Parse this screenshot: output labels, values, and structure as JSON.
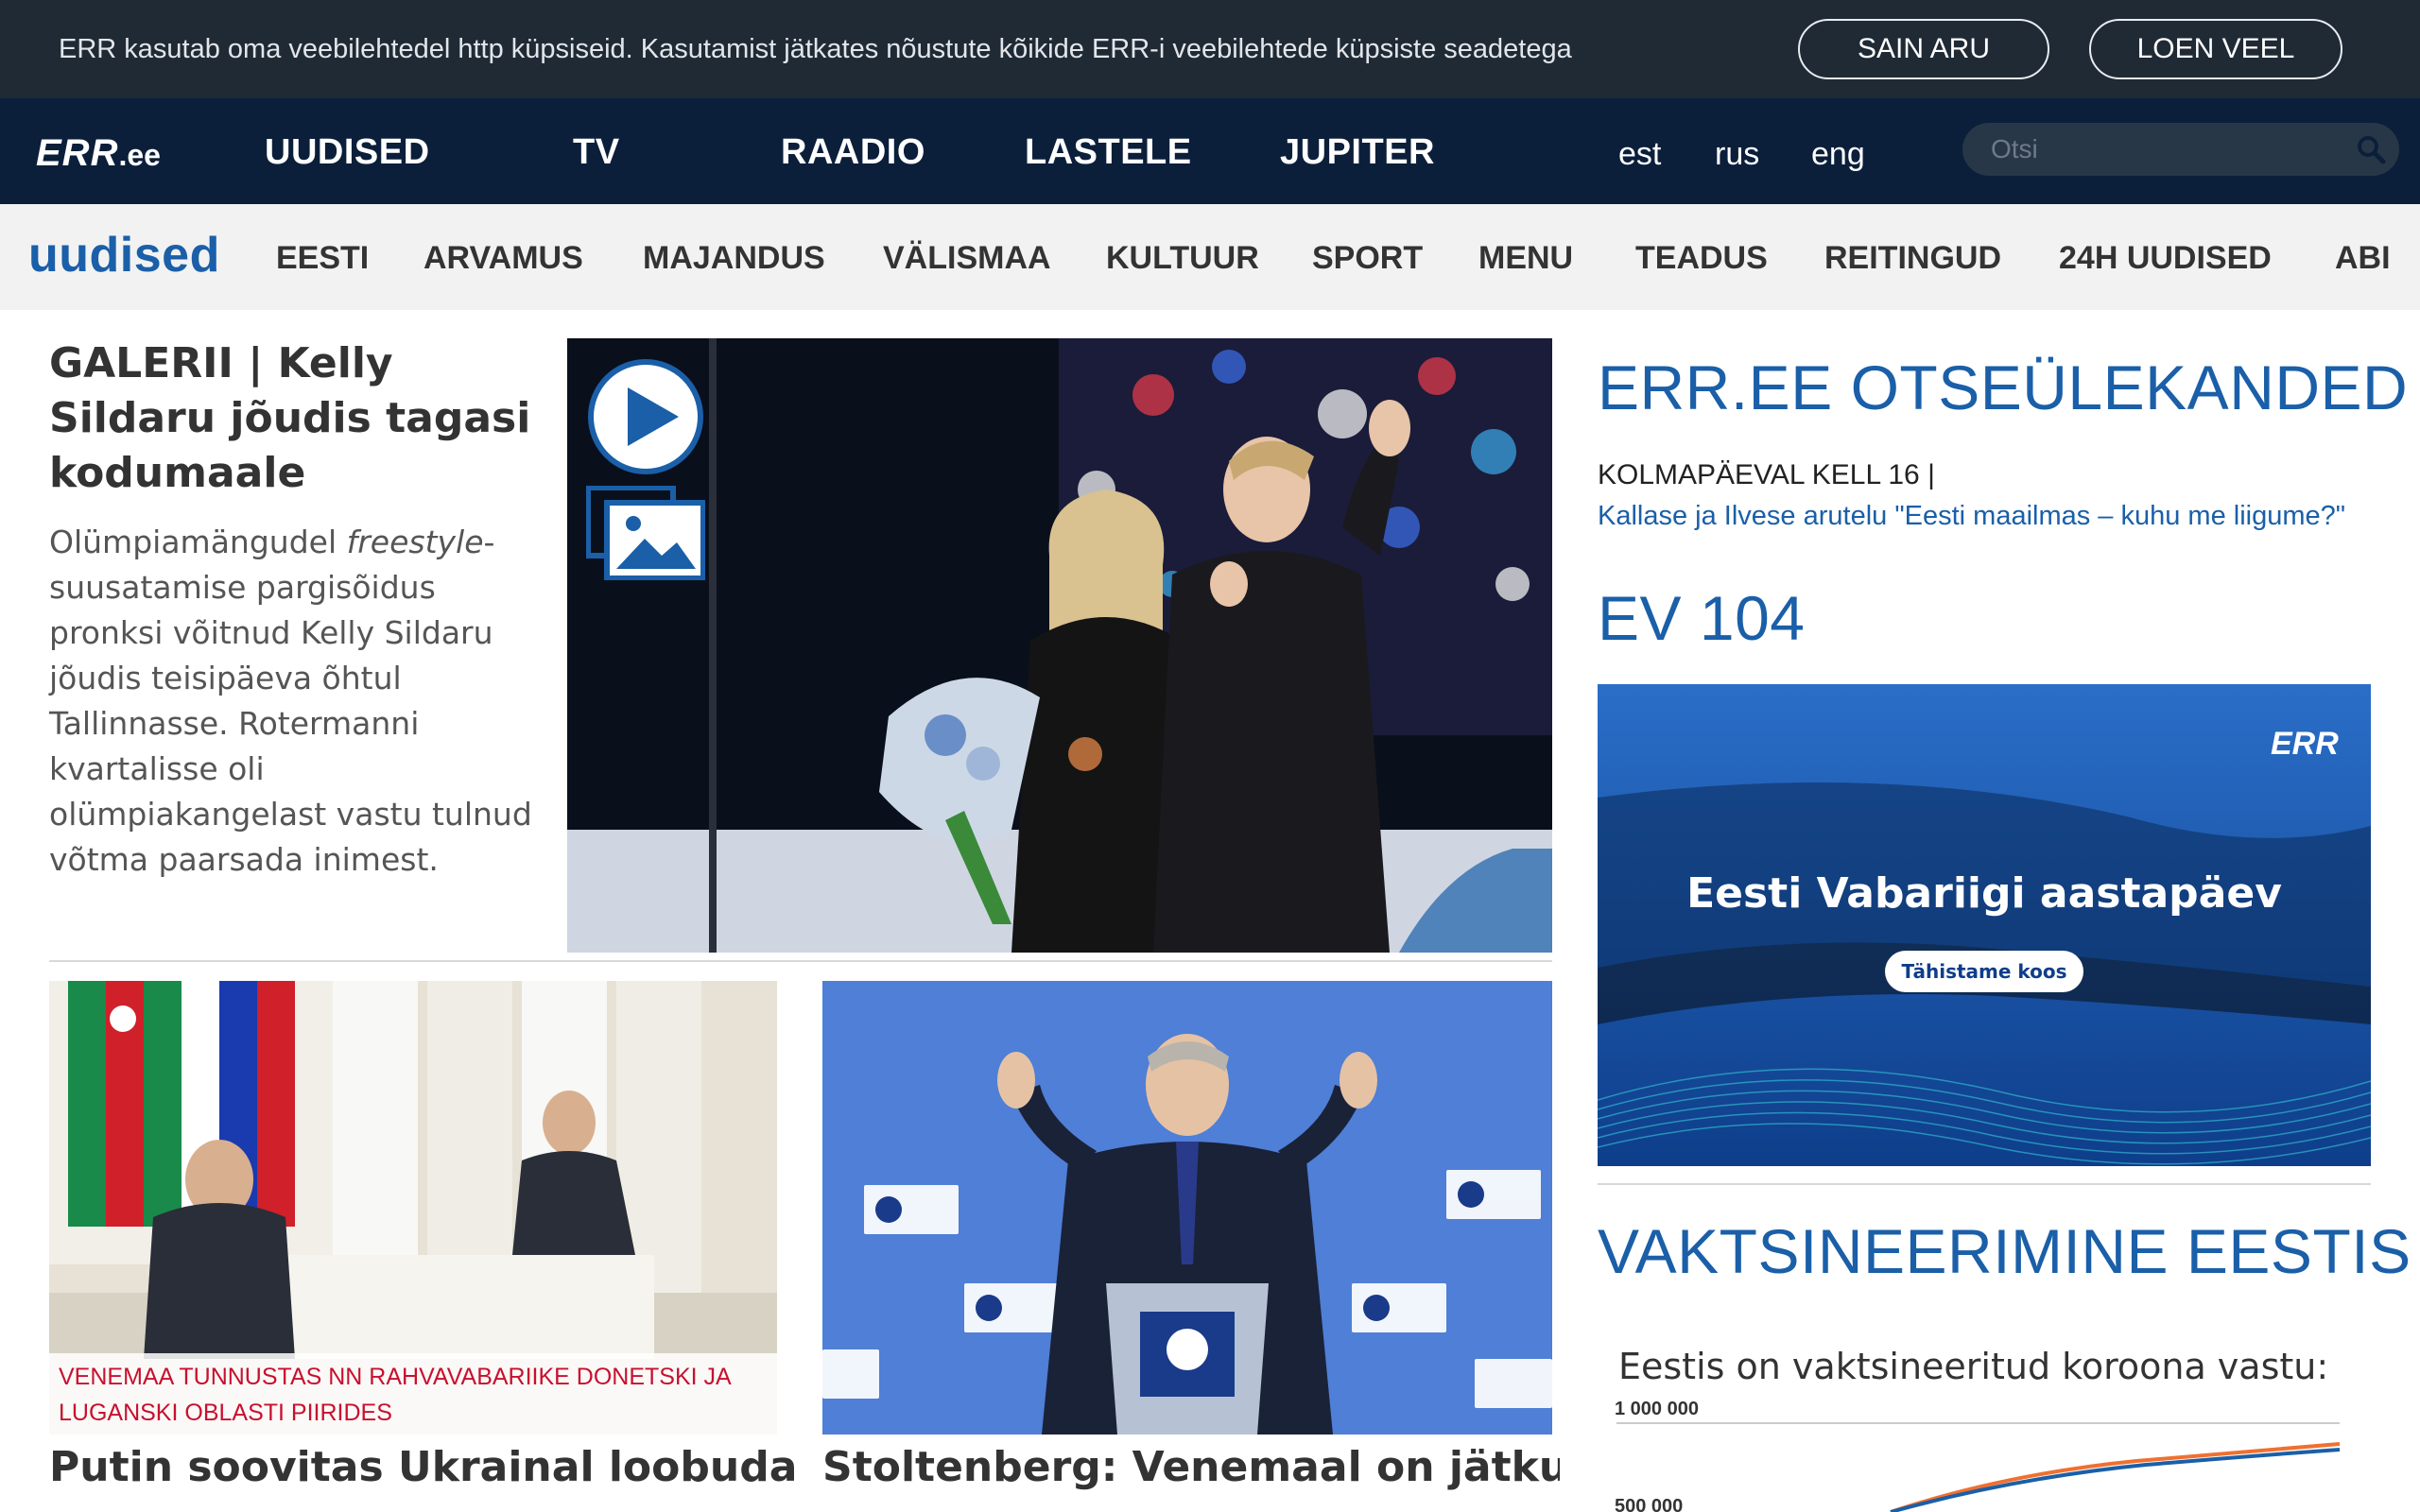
{
  "cookie_bar": {
    "text": "ERR kasutab oma veebilehtedel http küpsiseid. Kasutamist jätkates nõustute kõikide ERR-i veebilehtede küpsiste seadetega",
    "agree_label": "SAIN ARU",
    "more_label": "LOEN VEEL"
  },
  "header": {
    "logo_err": "ERR",
    "logo_ee": ".ee",
    "nav": [
      "UUDISED",
      "TV",
      "RAADIO",
      "LASTELE",
      "JUPITER"
    ],
    "langs": [
      "est",
      "rus",
      "eng"
    ],
    "search_placeholder": "Otsi"
  },
  "section_nav": {
    "brand": "uudised",
    "items": [
      "EESTI",
      "ARVAMUS",
      "MAJANDUS",
      "VÄLISMAA",
      "KULTUUR",
      "SPORT",
      "MENU",
      "TEADUS",
      "REITINGUD",
      "24H UUDISED",
      "ABI"
    ]
  },
  "lead": {
    "title": "GALERII | Kelly Sildaru jõudis tagasi kodumaale",
    "summary_pre": "Olümpiamängudel ",
    "summary_em": "freestyle",
    "summary_post": "-suusatamise pargisõidus pronksi võitnud Kelly Sildaru jõudis teisipäeva õhtul Tallinnasse. Rotermanni kvartalisse oli olümpiakangelast vastu tulnud võtma paarsada inimest."
  },
  "articles": [
    {
      "tag": "VENEMAA TUNNUSTAS NN RAHVAVABARIIKE DONETSKI JA LUGANSKI OBLASTI PIIRIDES",
      "title": "Putin soovitas Ukrainal loobuda NATO-sse püüdlemisest"
    },
    {
      "title": "Stoltenberg: Venemaal on jätkuvalt plaan ründa Ukrainat"
    }
  ],
  "sidebar": {
    "live_heading": "ERR.EE OTSEÜLEKANDED",
    "live_time": "KOLMAPÄEVAL KELL 16 |",
    "live_link": "Kallase ja Ilvese arutelu \"Eesti maailmas – kuhu me liigume?\"",
    "ev_heading": "EV 104",
    "ev_banner_logo": "ERR",
    "ev_banner_title": "Eesti Vabariigi aastapäev",
    "ev_banner_button": "Tähistame koos",
    "vax_heading": "VAKTSINEERIMINE EESTIS",
    "vax_sub": "Eestis on vaktsineeritud koroona vastu:",
    "vax_tick_top": "1 000 000",
    "vax_tick_second": "500 000"
  },
  "colors": {
    "cookie_bg": "#1f2a35",
    "topnav_bg": "#0b1f3b",
    "secnav_bg": "#f2f2f2",
    "brand_blue": "#1a5fa8",
    "tag_red": "#c8102e"
  }
}
